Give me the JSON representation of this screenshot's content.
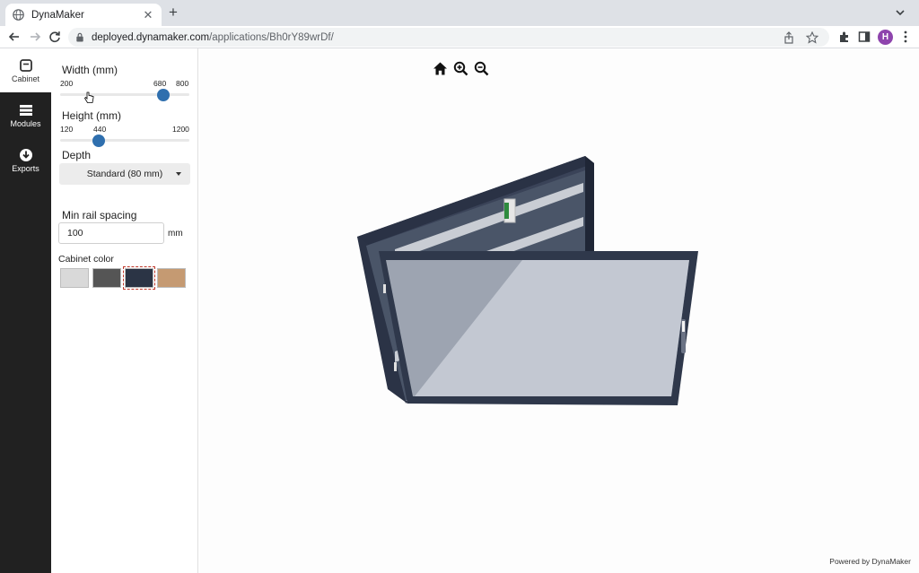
{
  "browser": {
    "tab_title": "DynaMaker",
    "url_host": "deployed.dynamaker.com",
    "url_path": "/applications/Bh0rY89wrDf/",
    "profile_initial": "H"
  },
  "nav": {
    "items": [
      {
        "label": "Cabinet",
        "icon": "cabinet-icon",
        "active": true
      },
      {
        "label": "Modules",
        "icon": "modules-icon",
        "active": false
      },
      {
        "label": "Exports",
        "icon": "download-icon",
        "active": false
      }
    ]
  },
  "panel": {
    "width": {
      "label": "Width (mm)",
      "min": "200",
      "value": "680",
      "max": "800",
      "fraction": 0.8
    },
    "height": {
      "label": "Height (mm)",
      "min": "120",
      "value": "440",
      "max": "1200",
      "fraction": 0.296
    },
    "depth": {
      "label": "Depth",
      "selected": "Standard (80 mm)"
    },
    "rail": {
      "label": "Min rail spacing",
      "value": "100",
      "unit": "mm"
    },
    "color": {
      "label": "Cabinet color",
      "swatches": [
        "#d9d9d9",
        "#555555",
        "#2b3445",
        "#c59a72"
      ],
      "selected_index": 2
    }
  },
  "viewport": {
    "tools": [
      "home-icon",
      "zoom-in-icon",
      "zoom-out-icon"
    ],
    "powered_by": "Powered by DynaMaker"
  }
}
